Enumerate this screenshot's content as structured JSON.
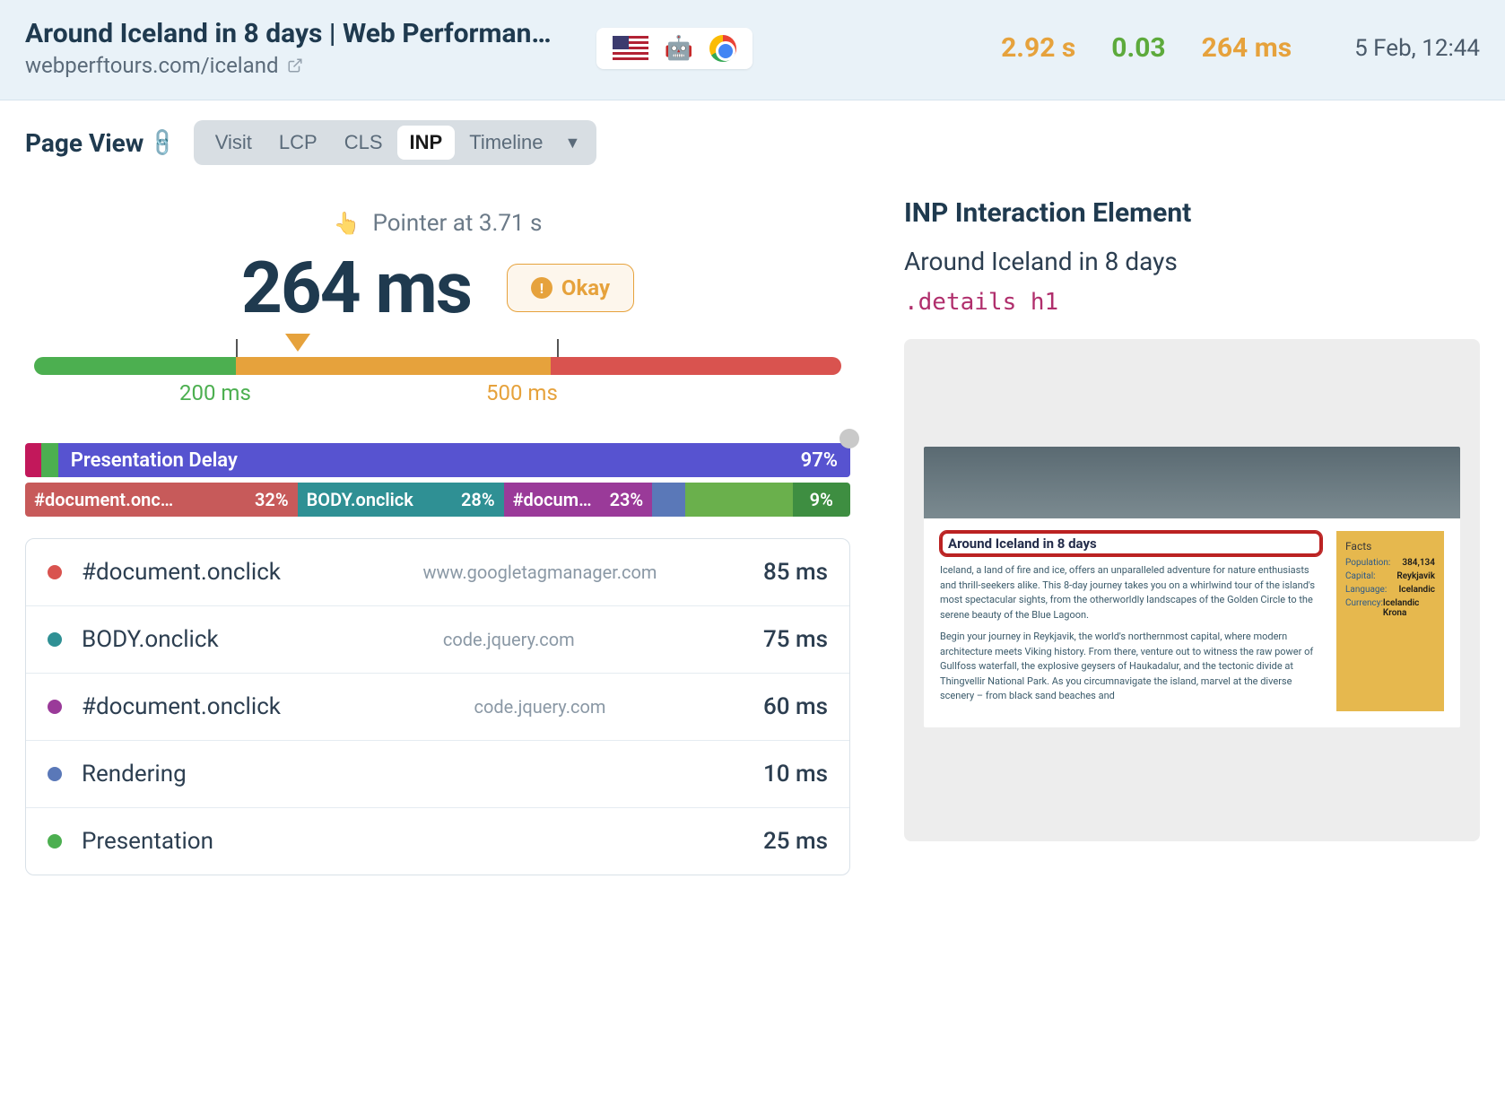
{
  "header": {
    "title": "Around Iceland in 8 days | Web Performan…",
    "url": "webperftours.com/iceland",
    "metrics": {
      "load": "2.92 s",
      "cls": "0.03",
      "inp": "264 ms"
    },
    "timestamp": "5 Feb, 12:44"
  },
  "subnav": {
    "title": "Page View",
    "tabs": [
      "Visit",
      "LCP",
      "CLS",
      "INP",
      "Timeline"
    ],
    "active": "INP"
  },
  "inp": {
    "pointer_label": "Pointer at 3.71 s",
    "value": "264 ms",
    "badge": "Okay",
    "range": {
      "low": "200 ms",
      "high": "500 ms"
    },
    "stack1": {
      "name": "Presentation Delay",
      "pct": "97%"
    },
    "stack2": [
      {
        "label": "#document.onc…",
        "pct": "32%"
      },
      {
        "label": "BODY.onclick",
        "pct": "28%"
      },
      {
        "label": "#docum…",
        "pct": "23%"
      },
      {
        "label": "",
        "pct": ""
      },
      {
        "label": "",
        "pct": ""
      },
      {
        "label": "",
        "pct": "9%"
      }
    ],
    "rows": [
      {
        "color": "red",
        "label": "#document.onclick",
        "src": "www.googletagmanager.com",
        "ms": "85 ms"
      },
      {
        "color": "teal",
        "label": "BODY.onclick",
        "src": "code.jquery.com",
        "ms": "75 ms"
      },
      {
        "color": "purple",
        "label": "#document.onclick",
        "src": "code.jquery.com",
        "ms": "60 ms"
      },
      {
        "color": "blue",
        "label": "Rendering",
        "src": "",
        "ms": "10 ms"
      },
      {
        "color": "green",
        "label": "Presentation",
        "src": "",
        "ms": "25 ms"
      }
    ]
  },
  "right": {
    "title": "INP Interaction Element",
    "subtitle": "Around Iceland in 8 days",
    "selector": ".details h1",
    "preview": {
      "h1": "Around Iceland in 8 days",
      "p1": "Iceland, a land of fire and ice, offers an unparalleled adventure for nature enthusiasts and thrill-seekers alike. This 8-day journey takes you on a whirlwind tour of the island's most spectacular sights, from the otherworldly landscapes of the Golden Circle to the serene beauty of the Blue Lagoon.",
      "p2": "Begin your journey in Reykjavik, the world's northernmost capital, where modern architecture meets Viking history. From there, venture out to witness the raw power of Gullfoss waterfall, the explosive geysers of Haukadalur, and the tectonic divide at Thingvellir National Park. As you circumnavigate the island, marvel at the diverse scenery – from black sand beaches and",
      "facts": {
        "title": "Facts",
        "population_k": "Population:",
        "population_v": "384,134",
        "capital_k": "Capital:",
        "capital_v": "Reykjavik",
        "language_k": "Language:",
        "language_v": "Icelandic",
        "currency_k": "Currency:",
        "currency_v": "Icelandic Krona"
      }
    }
  }
}
